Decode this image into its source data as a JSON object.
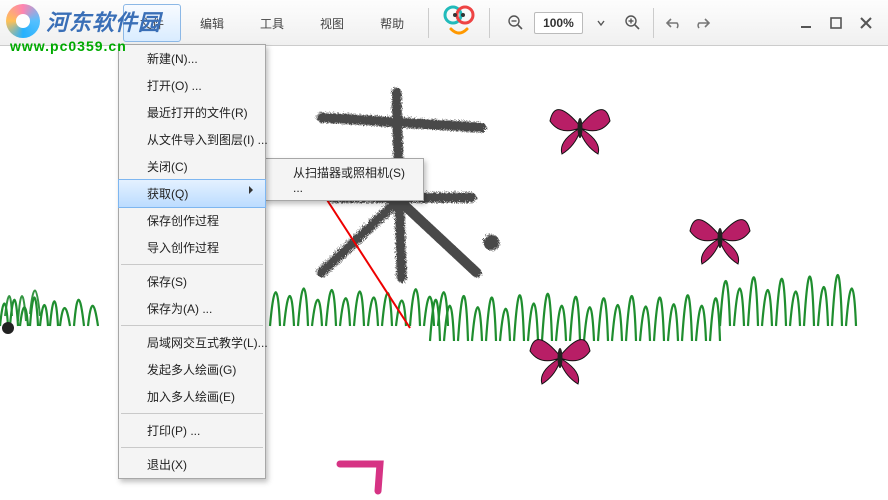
{
  "watermark": {
    "site_name": "河东软件园",
    "url": "www.pc0359.cn"
  },
  "menubar": {
    "file": "文件",
    "edit": "编辑",
    "tool": "工具",
    "view": "视图",
    "help": "帮助"
  },
  "zoom": {
    "value": "100%"
  },
  "file_menu": {
    "new": "新建(N)...",
    "open": "打开(O) ...",
    "recent": "最近打开的文件(R)",
    "import_layer": "从文件导入到图层(I) ...",
    "close": "关闭(C)",
    "acquire": "获取(Q)",
    "save_process": "保存创作过程",
    "import_process": "导入创作过程",
    "save": "保存(S)",
    "save_as": "保存为(A) ...",
    "lan_teach": "局域网交互式教学(L)...",
    "start_multi": "发起多人绘画(G)",
    "join_multi": "加入多人绘画(E)",
    "print": "打印(P) ...",
    "exit": "退出(X)"
  },
  "acquire_submenu": {
    "scanner": "从扫描器或照相机(S) ..."
  }
}
